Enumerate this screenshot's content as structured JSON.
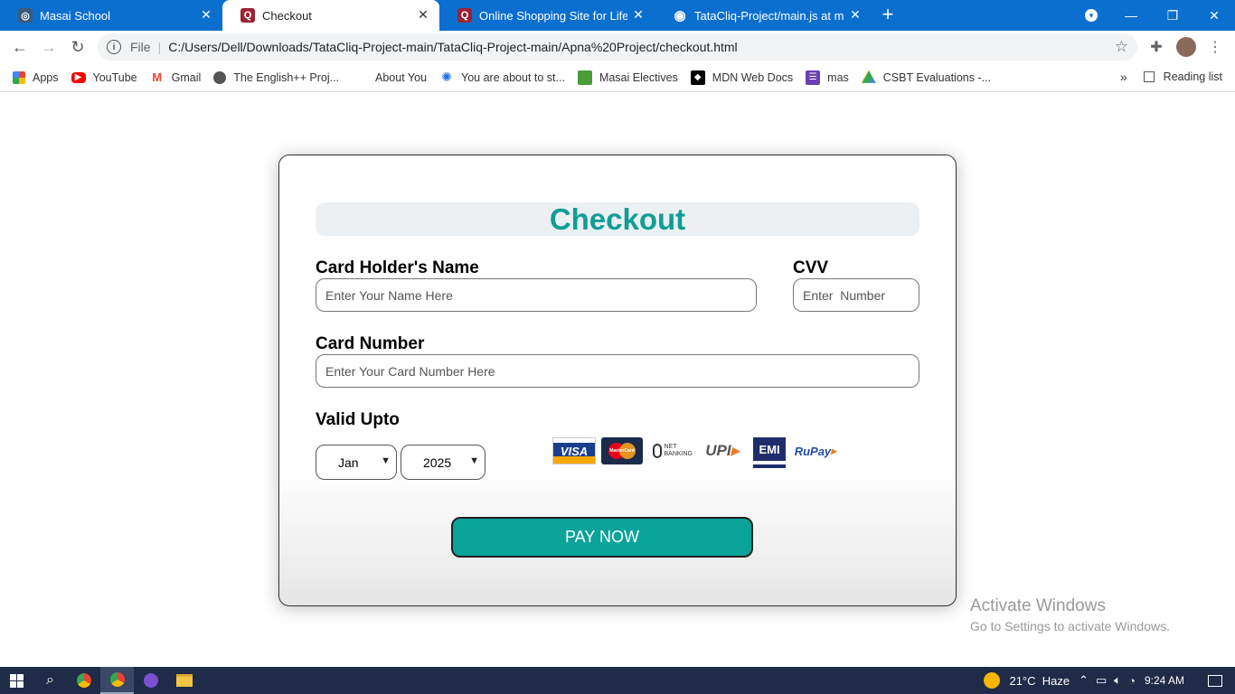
{
  "browser": {
    "tabs": [
      {
        "title": "Masai School",
        "fav_color": "#3b5a7a",
        "fav_glyph": "◎"
      },
      {
        "title": "Checkout",
        "fav_color": "#9b2335",
        "fav_glyph": "Q"
      },
      {
        "title": "Online Shopping Site for Lifestyle",
        "fav_color": "#9b2335",
        "fav_glyph": "Q"
      },
      {
        "title": "TataCliq-Project/main.js at main",
        "fav_color": "#222",
        "fav_glyph": "◉"
      }
    ],
    "new_tab": "+",
    "address": {
      "security_label": "File",
      "url": "C:/Users/Dell/Downloads/TataCliq-Project-main/TataCliq-Project-main/Apna%20Project/checkout.html"
    },
    "bookmarks": [
      {
        "label": "Apps",
        "icon": "apps-grid-icon"
      },
      {
        "label": "YouTube",
        "icon": "youtube-icon"
      },
      {
        "label": "Gmail",
        "icon": "gmail-icon"
      },
      {
        "label": "The English++ Proj...",
        "icon": "globe-icon"
      },
      {
        "label": "About You",
        "icon": "none"
      },
      {
        "label": "You are about to st...",
        "icon": "bulb-icon"
      },
      {
        "label": "Masai Electives",
        "icon": "book-icon"
      },
      {
        "label": "MDN Web Docs",
        "icon": "mdn-icon"
      },
      {
        "label": "mas",
        "icon": "list-icon"
      },
      {
        "label": "CSBT Evaluations -...",
        "icon": "drive-icon"
      }
    ],
    "more_bookmarks": "»",
    "reading_list": "Reading list"
  },
  "checkout": {
    "title": "Checkout",
    "name_label": "Card Holder's Name",
    "name_placeholder": "Enter Your Name Here",
    "cvv_label": "CVV",
    "cvv_placeholder": "Enter  Number",
    "card_label": "Card Number",
    "card_placeholder": "Enter Your Card Number Here",
    "valid_label": "Valid Upto",
    "month_value": "Jan",
    "year_value": "2025",
    "payment_methods": [
      "VISA",
      "MasterCard",
      "NET BANKING",
      "UPI",
      "EMI",
      "RuPay"
    ],
    "pay_button": "PAY NOW",
    "accent_color": "#0aa39a"
  },
  "watermark": {
    "line1": "Activate Windows",
    "line2": "Go to Settings to activate Windows."
  },
  "taskbar": {
    "weather": "21°C  Haze",
    "time": "9:24 AM"
  }
}
